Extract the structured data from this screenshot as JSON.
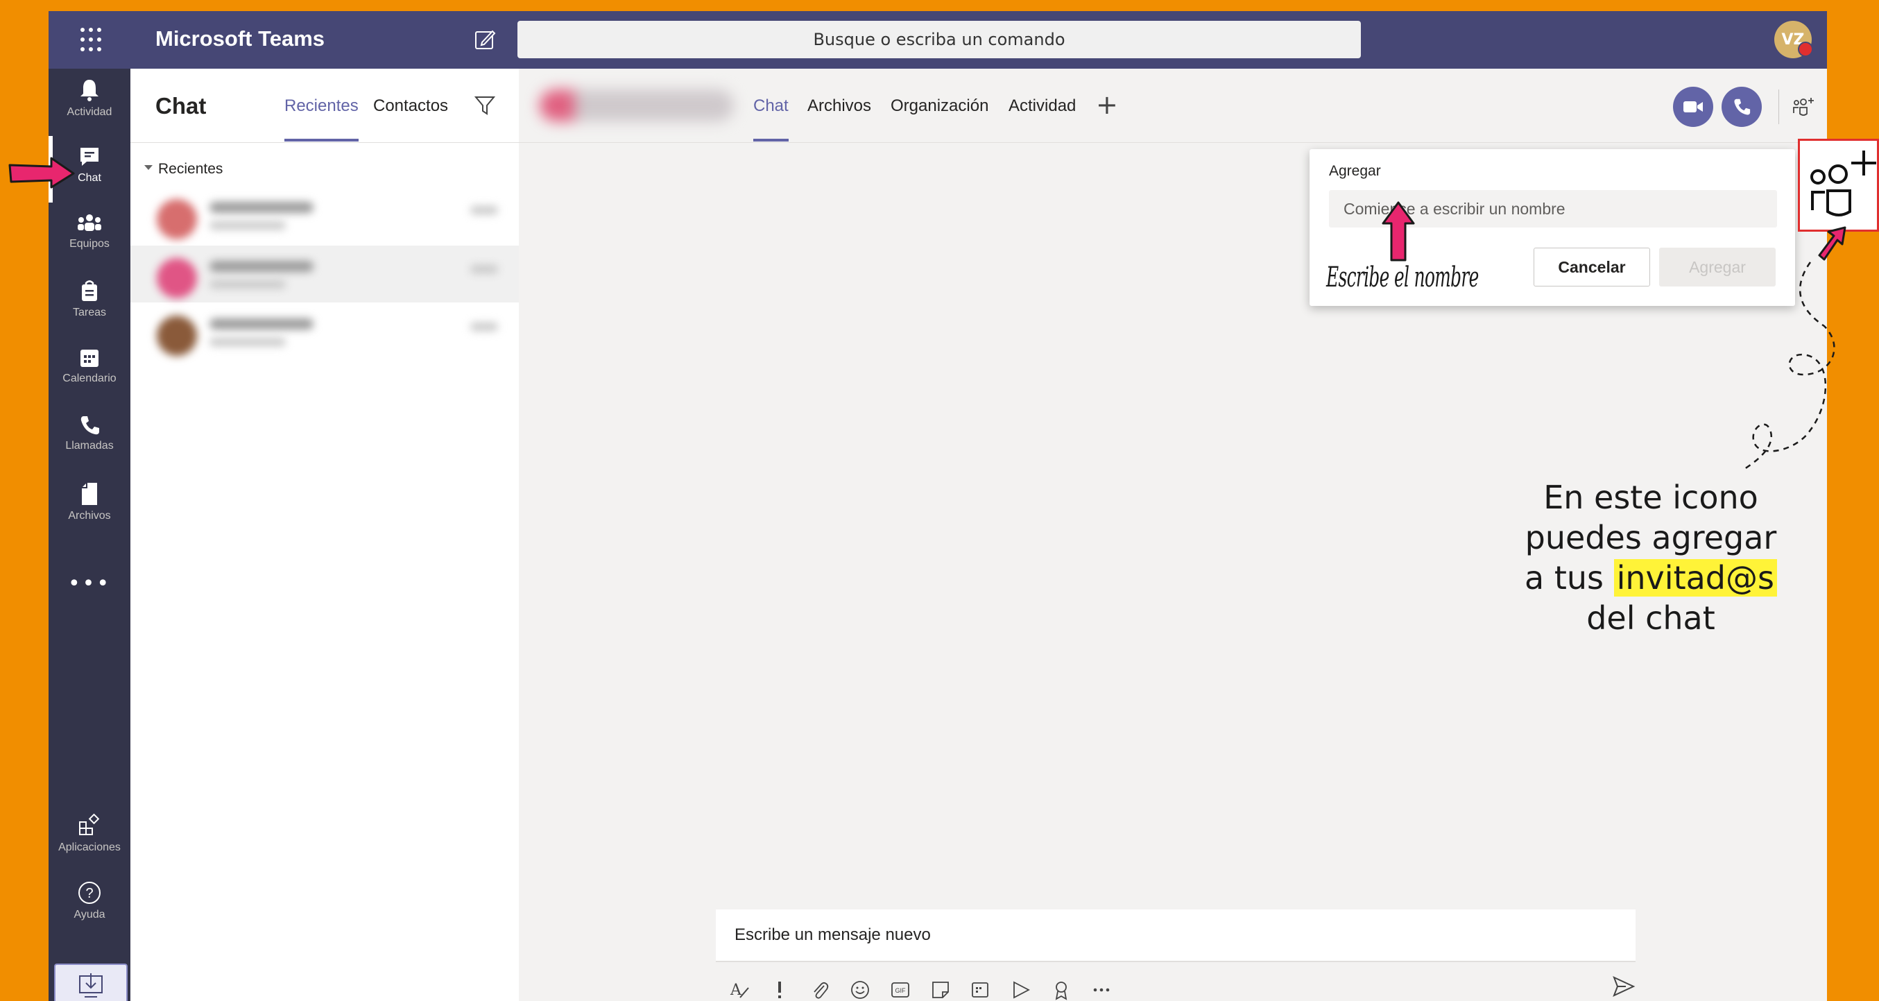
{
  "titlebar": {
    "app_title": "Microsoft Teams",
    "search_placeholder": "Busque o escriba un comando",
    "avatar_initials": "VZ"
  },
  "rail": {
    "items": [
      {
        "label": "Actividad",
        "icon": "bell-icon"
      },
      {
        "label": "Chat",
        "icon": "chat-icon",
        "active": true
      },
      {
        "label": "Equipos",
        "icon": "teams-icon"
      },
      {
        "label": "Tareas",
        "icon": "tasks-icon"
      },
      {
        "label": "Calendario",
        "icon": "calendar-icon"
      },
      {
        "label": "Llamadas",
        "icon": "phone-icon"
      },
      {
        "label": "Archivos",
        "icon": "files-icon"
      }
    ],
    "more": "•••",
    "bottom": [
      {
        "label": "Aplicaciones",
        "icon": "apps-icon"
      },
      {
        "label": "Ayuda",
        "icon": "help-icon"
      }
    ]
  },
  "chat_list": {
    "title": "Chat",
    "tabs": [
      "Recientes",
      "Contactos"
    ],
    "section": "Recientes"
  },
  "main": {
    "tabs": [
      "Chat",
      "Archivos",
      "Organización",
      "Actividad"
    ],
    "add_tab": "+"
  },
  "popup": {
    "label": "Agregar",
    "input_placeholder": "Comience a escribir un nombre",
    "cancel_label": "Cancelar",
    "add_label": "Agregar",
    "note": "Escribe el nombre"
  },
  "compose": {
    "placeholder": "Escribe un mensaje nuevo"
  },
  "annotation": {
    "line1": "En este icono",
    "line2": "puedes agregar",
    "line3_pre": "a tus ",
    "line3_highlight": "invitad@s",
    "line4": "del chat"
  },
  "colors": {
    "background": "#F18E00",
    "accent": "#6264A7",
    "titlebar": "#464775",
    "rail": "#33344A",
    "arrow": "#E8266E",
    "highlight": "#FFF338"
  }
}
